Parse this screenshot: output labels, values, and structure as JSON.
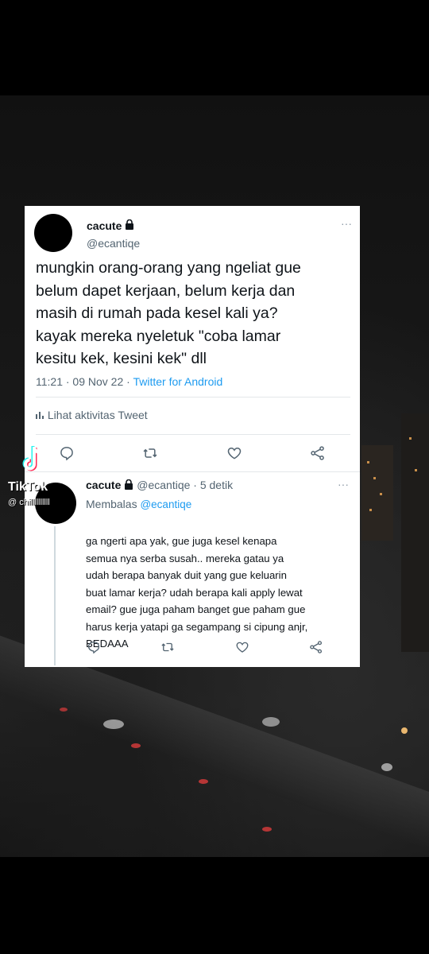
{
  "tweet": {
    "display_name": "cacute",
    "handle": "@ecantiqe",
    "text": "mungkin orang-orang yang ngeliat gue\nbelum dapet kerjaan, belum kerja dan\nmasih di rumah pada kesel kali ya?\nkayak mereka nyeletuk \"coba lamar\nkesitu kek, kesini kek\" dll",
    "time": "11:21 · 09 Nov 22 · ",
    "source": "Twitter for Android",
    "activity_label": "Lihat aktivitas Tweet"
  },
  "reply": {
    "display_name": "cacute",
    "handle_time": "@ecantiqe · 5 detik",
    "replying_prefix": "Membalas ",
    "replying_to": "@ecantiqe",
    "text": "ga ngerti apa yak, gue juga kesel kenapa\nsemua nya serba susah.. mereka gatau ya\nudah berapa banyak duit yang gue keluarin\nbuat lamar kerja? udah berapa kali apply lewat\nemail? gue juga paham banget gue paham gue\nharus kerja yatapi ga segampang si cipung anjr,\nBEDAAA"
  },
  "tiktok": {
    "brand": "TikTok",
    "username": "@ chillllllllll"
  },
  "colors": {
    "link": "#1d9bf0",
    "secondary_text": "#536471",
    "icon_gray": "#536471"
  },
  "icons": [
    "lock-icon",
    "more-icon",
    "reply-icon",
    "retweet-icon",
    "like-icon",
    "share-icon",
    "bar-chart-icon",
    "tiktok-logo-icon"
  ]
}
